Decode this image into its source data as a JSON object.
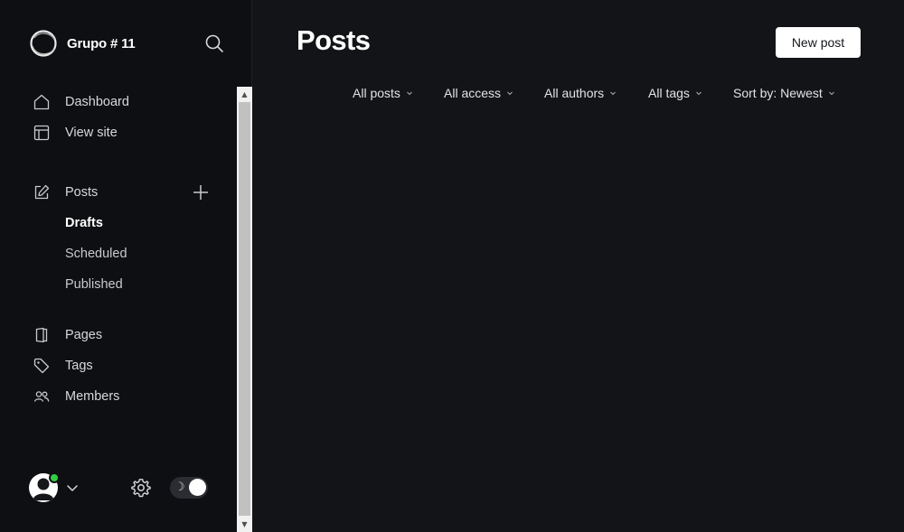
{
  "brand": {
    "name": "Grupo # 11"
  },
  "nav": {
    "primary": [
      {
        "label": "Dashboard",
        "icon": "home-icon"
      },
      {
        "label": "View site",
        "icon": "layout-icon"
      }
    ],
    "posts": {
      "label": "Posts",
      "icon": "edit-icon"
    },
    "posts_sub": [
      {
        "label": "Drafts",
        "active": true
      },
      {
        "label": "Scheduled",
        "active": false
      },
      {
        "label": "Published",
        "active": false
      }
    ],
    "secondary": [
      {
        "label": "Pages",
        "icon": "page-icon"
      },
      {
        "label": "Tags",
        "icon": "tag-icon"
      },
      {
        "label": "Members",
        "icon": "members-icon"
      }
    ]
  },
  "footer": {
    "theme_icon": "☽"
  },
  "main": {
    "title": "Posts",
    "new_post_label": "New post",
    "filters": [
      {
        "label": "All posts"
      },
      {
        "label": "All access"
      },
      {
        "label": "All authors"
      },
      {
        "label": "All tags"
      },
      {
        "label": "Sort by: Newest"
      }
    ]
  },
  "scrollbar": {
    "up": "▲",
    "down": "▼"
  },
  "colors": {
    "accent_online": "#30cf43",
    "background": "#131417",
    "sidebar": "#0e0f12"
  }
}
